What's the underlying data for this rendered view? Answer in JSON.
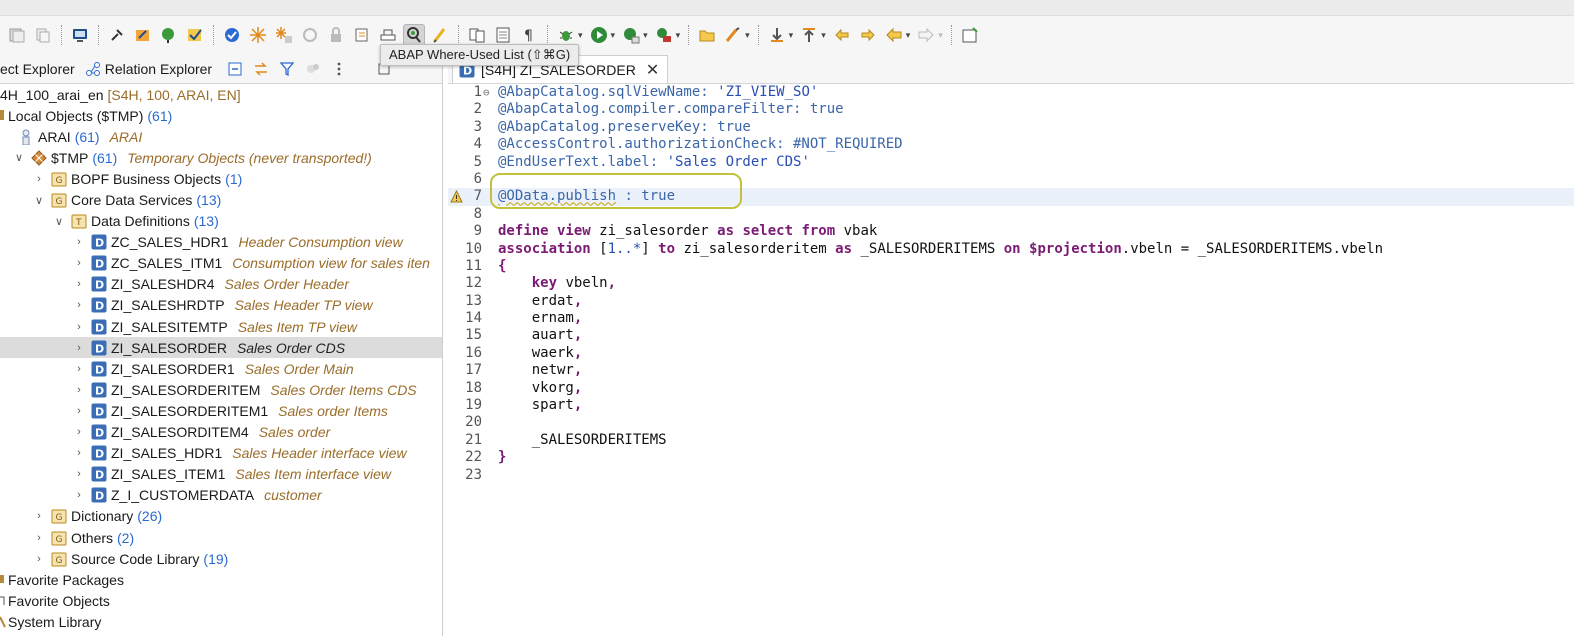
{
  "toolbar": {
    "tooltip": "ABAP Where-Used List (⇧⌘G)"
  },
  "left_panel": {
    "tabs": [
      {
        "label": "ect Explorer"
      },
      {
        "label": "Relation Explorer"
      }
    ],
    "tree": [
      {
        "label": "4H_100_arai_en",
        "meta": "[S4H, 100, ARAI, EN]"
      },
      {
        "label": "Local Objects ($TMP)",
        "count": "(61)"
      },
      {
        "label": "ARAI",
        "count": "(61)",
        "desc": "ARAI"
      },
      {
        "label": "$TMP",
        "count": "(61)",
        "desc": "Temporary Objects (never transported!)"
      },
      {
        "label": "BOPF Business Objects",
        "count": "(1)"
      },
      {
        "label": "Core Data Services",
        "count": "(13)"
      },
      {
        "label": "Data Definitions",
        "count": "(13)"
      },
      {
        "label": "ZC_SALES_HDR1",
        "desc": "Header Consumption view"
      },
      {
        "label": "ZC_SALES_ITM1",
        "desc": "Consumption view for sales iten"
      },
      {
        "label": "ZI_SALESHDR4",
        "desc": "Sales Order Header"
      },
      {
        "label": "ZI_SALESHRDTP",
        "desc": "Sales Header TP view"
      },
      {
        "label": "ZI_SALESITEMTP",
        "desc": "Sales Item TP view"
      },
      {
        "label": "ZI_SALESORDER",
        "desc": "Sales Order CDS"
      },
      {
        "label": "ZI_SALESORDER1",
        "desc": "Sales Order Main"
      },
      {
        "label": "ZI_SALESORDERITEM",
        "desc": "Sales Order Items CDS"
      },
      {
        "label": "ZI_SALESORDERITEM1",
        "desc": "Sales order Items"
      },
      {
        "label": "ZI_SALESORDITEM4",
        "desc": "Sales order"
      },
      {
        "label": "ZI_SALES_HDR1",
        "desc": "Sales Header interface view"
      },
      {
        "label": "ZI_SALES_ITEM1",
        "desc": "Sales Item interface view"
      },
      {
        "label": "Z_I_CUSTOMERDATA",
        "desc": "customer"
      },
      {
        "label": "Dictionary",
        "count": "(26)"
      },
      {
        "label": "Others",
        "count": "(2)"
      },
      {
        "label": "Source Code Library",
        "count": "(19)"
      },
      {
        "label": "Favorite Packages"
      },
      {
        "label": "Favorite Objects"
      },
      {
        "label": "System Library"
      }
    ]
  },
  "editor": {
    "tab_label": "[S4H] ZI_SALESORDER",
    "lines": [
      {
        "n": "1",
        "parts": [
          {
            "t": "@AbapCatalog.sqlViewName: ",
            "c": "anno"
          },
          {
            "t": "'ZI_VIEW_SO'",
            "c": "str"
          }
        ]
      },
      {
        "n": "2",
        "parts": [
          {
            "t": "@AbapCatalog.compiler.compareFilter: true",
            "c": "anno"
          }
        ]
      },
      {
        "n": "3",
        "parts": [
          {
            "t": "@AbapCatalog.preserveKey: true",
            "c": "anno"
          }
        ]
      },
      {
        "n": "4",
        "parts": [
          {
            "t": "@AccessControl.authorizationCheck: #NOT_REQUIRED",
            "c": "anno"
          }
        ]
      },
      {
        "n": "5",
        "parts": [
          {
            "t": "@EndUserText.label: ",
            "c": "anno"
          },
          {
            "t": "'Sales Order CDS'",
            "c": "str"
          }
        ]
      },
      {
        "n": "6",
        "parts": []
      },
      {
        "n": "7",
        "parts": [
          {
            "t": "@OData.publish",
            "c": "anno squig"
          },
          {
            "t": " : true",
            "c": "anno"
          }
        ]
      },
      {
        "n": "8",
        "parts": []
      },
      {
        "n": "9",
        "parts": [
          {
            "t": "define view",
            "c": "kw"
          },
          {
            "t": " zi_salesorder ",
            "c": "plain"
          },
          {
            "t": "as select from",
            "c": "kw"
          },
          {
            "t": " vbak",
            "c": "plain"
          }
        ]
      },
      {
        "n": "10",
        "parts": [
          {
            "t": "association",
            "c": "kw"
          },
          {
            "t": " [",
            "c": "plain"
          },
          {
            "t": "1..*",
            "c": "str"
          },
          {
            "t": "] ",
            "c": "plain"
          },
          {
            "t": "to",
            "c": "kw"
          },
          {
            "t": " zi_salesorderitem ",
            "c": "plain"
          },
          {
            "t": "as",
            "c": "kw"
          },
          {
            "t": " _SALESORDERITEMS ",
            "c": "plain"
          },
          {
            "t": "on",
            "c": "kw"
          },
          {
            "t": " ",
            "c": "plain"
          },
          {
            "t": "$projection",
            "c": "kw"
          },
          {
            "t": ".vbeln = _SALESORDERITEMS.vbeln",
            "c": "plain"
          }
        ]
      },
      {
        "n": "11",
        "parts": [
          {
            "t": "{",
            "c": "kw"
          }
        ]
      },
      {
        "n": "12",
        "parts": [
          {
            "t": "    ",
            "c": "plain"
          },
          {
            "t": "key",
            "c": "kw"
          },
          {
            "t": " vbeln",
            "c": "plain"
          },
          {
            "t": ",",
            "c": "kw"
          }
        ]
      },
      {
        "n": "13",
        "parts": [
          {
            "t": "    erdat",
            "c": "plain"
          },
          {
            "t": ",",
            "c": "kw"
          }
        ]
      },
      {
        "n": "14",
        "parts": [
          {
            "t": "    ernam",
            "c": "plain"
          },
          {
            "t": ",",
            "c": "kw"
          }
        ]
      },
      {
        "n": "15",
        "parts": [
          {
            "t": "    auart",
            "c": "plain"
          },
          {
            "t": ",",
            "c": "kw"
          }
        ]
      },
      {
        "n": "16",
        "parts": [
          {
            "t": "    waerk",
            "c": "plain"
          },
          {
            "t": ",",
            "c": "kw"
          }
        ]
      },
      {
        "n": "17",
        "parts": [
          {
            "t": "    netwr",
            "c": "plain"
          },
          {
            "t": ",",
            "c": "kw"
          }
        ]
      },
      {
        "n": "18",
        "parts": [
          {
            "t": "    vkorg",
            "c": "plain"
          },
          {
            "t": ",",
            "c": "kw"
          }
        ]
      },
      {
        "n": "19",
        "parts": [
          {
            "t": "    spart",
            "c": "plain"
          },
          {
            "t": ",",
            "c": "kw"
          }
        ]
      },
      {
        "n": "20",
        "parts": []
      },
      {
        "n": "21",
        "parts": [
          {
            "t": "    _SALESORDERITEMS",
            "c": "plain"
          }
        ]
      },
      {
        "n": "22",
        "parts": [
          {
            "t": "}",
            "c": "kw"
          }
        ]
      },
      {
        "n": "23",
        "parts": []
      }
    ]
  },
  "colors": {
    "accent_blue": "#2a6ad1",
    "description_brown": "#9a6d2a",
    "keyword_purple": "#7b1a74",
    "annotation_blue": "#3b66a8",
    "highlight_olive": "#c3c13b",
    "selection_gray": "#dcdcdc"
  }
}
